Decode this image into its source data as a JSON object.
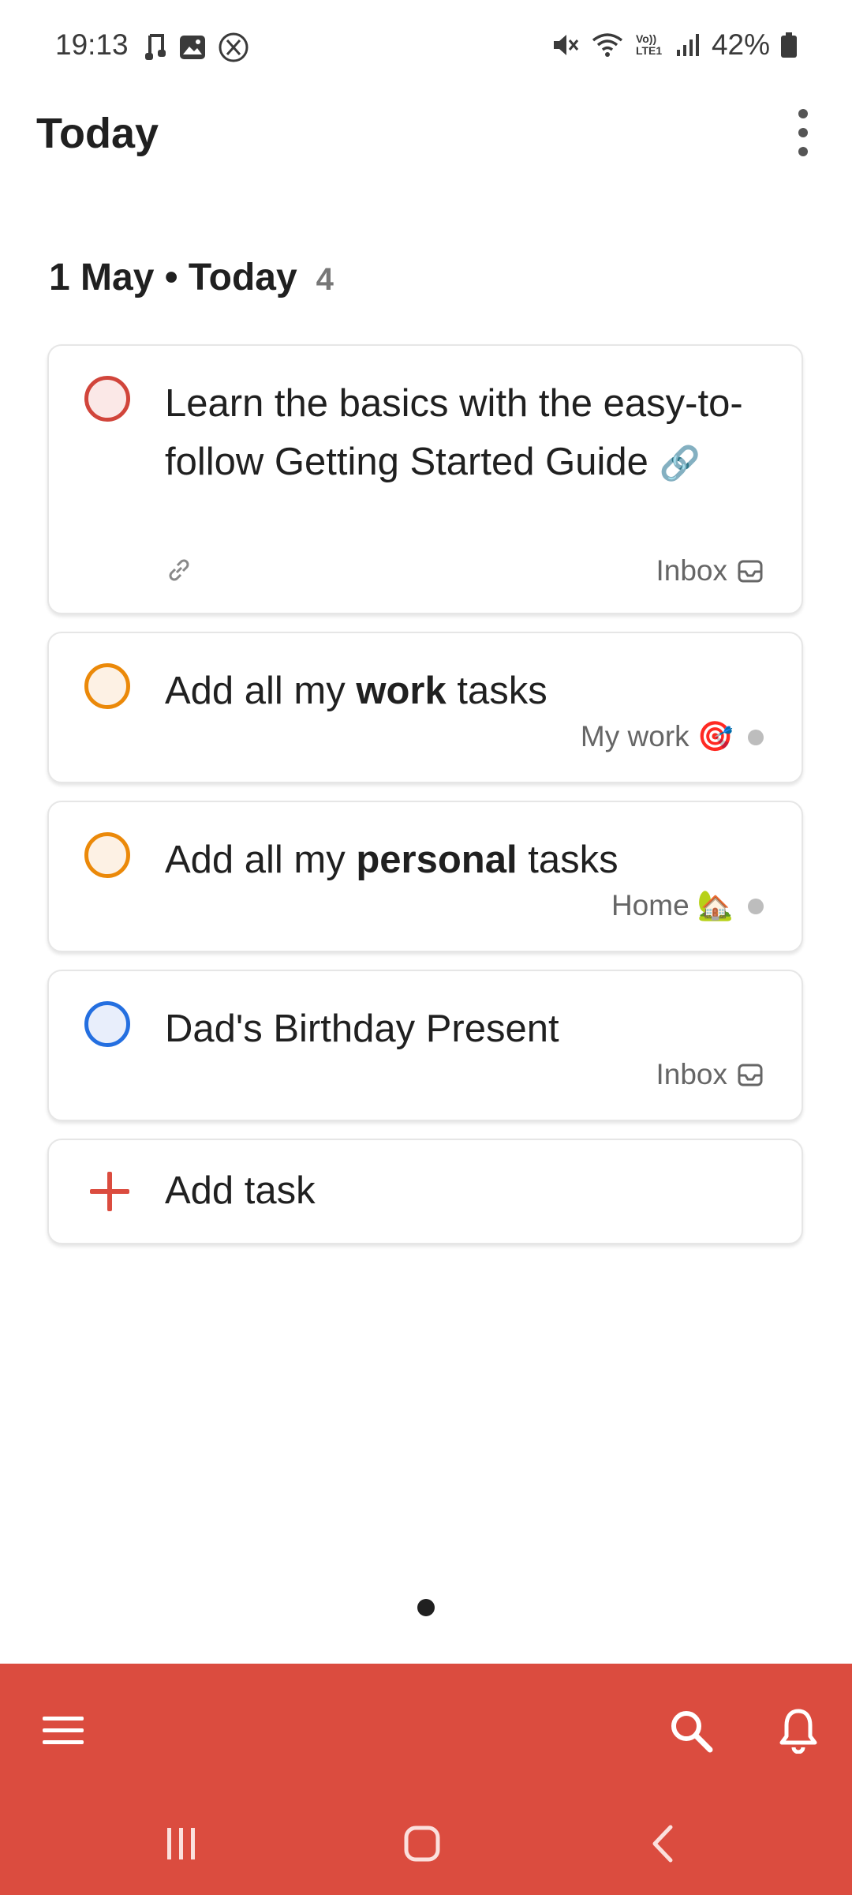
{
  "status_bar": {
    "time": "19:13",
    "left_icons": [
      "music-note-icon",
      "gallery-icon",
      "x-app-icon"
    ],
    "right_icons": [
      "mute-icon",
      "wifi-icon",
      "volte-icon",
      "signal-icon"
    ],
    "volte_text": "Vo)) LTE1",
    "battery_percent": "42%",
    "battery_level": 0.42
  },
  "app_bar": {
    "title": "Today"
  },
  "section": {
    "label": "1 May • Today",
    "count": "4"
  },
  "tasks": [
    {
      "title_text": "Learn the basics with the easy-to-follow Getting Started Guide",
      "title_emoji": "🔗",
      "has_link": true,
      "project": "Inbox",
      "project_icon": "inbox-icon",
      "circle_color": "#d1453b"
    },
    {
      "title_before": "Add all my ",
      "title_bold": "work",
      "title_after": " tasks",
      "project": "My work 🎯",
      "project_icon": "dot",
      "circle_color": "#eb8909"
    },
    {
      "title_before": "Add all my ",
      "title_bold": "personal",
      "title_after": " tasks",
      "project": "Home 🏡",
      "project_icon": "dot",
      "circle_color": "#eb8909"
    },
    {
      "title_text": "Dad's Birthday Present",
      "project": "Inbox",
      "project_icon": "inbox-icon",
      "circle_color": "#246fe0"
    }
  ],
  "add_task": {
    "label": "Add task"
  },
  "colors": {
    "accent": "#db4c3f",
    "text": "#202020",
    "muted": "#666666"
  },
  "bottom_bar": {
    "icons": [
      "menu-icon",
      "search-icon",
      "bell-icon"
    ]
  },
  "system_nav": {
    "icons": [
      "recents-icon",
      "home-icon",
      "back-icon"
    ]
  }
}
